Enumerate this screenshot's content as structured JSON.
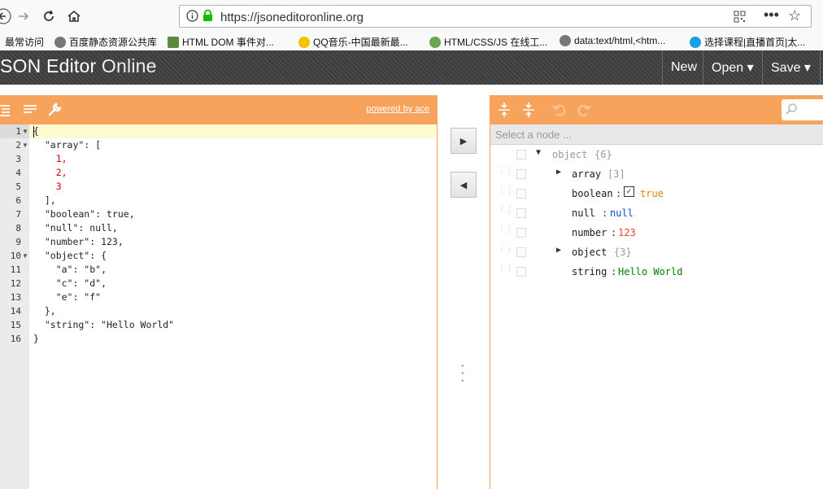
{
  "browser": {
    "url": "https://jsoneditoronline.org",
    "bookmarks": [
      "最常访问",
      "百度静态资源公共库",
      "HTML DOM 事件对...",
      "QQ音乐-中国最新最...",
      "HTML/CSS/JS 在线工...",
      "data:text/html,<htm...",
      "选择课程|直播首页|太..."
    ]
  },
  "app": {
    "title_bold": "SON Editor",
    "title_thin": "Online",
    "menu": {
      "new": "New",
      "open": "Open ▾",
      "save": "Save ▾"
    }
  },
  "left": {
    "powered_by": "powered by ace",
    "line_numbers": [
      "1",
      "2",
      "3",
      "4",
      "5",
      "6",
      "7",
      "8",
      "9",
      "10",
      "11",
      "12",
      "13",
      "14",
      "15",
      "16"
    ],
    "lines": [
      "{",
      "  \"array\": [",
      "    1,",
      "    2,",
      "    3",
      "  ],",
      "  \"boolean\": true,",
      "  \"null\": null,",
      "  \"number\": 123,",
      "  \"object\": {",
      "    \"a\": \"b\",",
      "    \"c\": \"d\",",
      "    \"e\": \"f\"",
      "  },",
      "  \"string\": \"Hello World\"",
      "}"
    ]
  },
  "middle": {
    "to_right": "▶",
    "to_left": "◀"
  },
  "right": {
    "navbar_placeholder": "Select a node ...",
    "tree": {
      "root_label": "object",
      "root_count": "{6}",
      "array_key": "array",
      "array_count": "[3]",
      "boolean_key": "boolean",
      "boolean_value": "true",
      "null_key": "null",
      "null_value": "null",
      "number_key": "number",
      "number_value": "123",
      "object_key": "object",
      "object_count": "{3}",
      "string_key": "string",
      "string_value": "Hello World",
      "separator": ":"
    }
  },
  "colors": {
    "accent": "#f7a35c",
    "header": "#404040"
  }
}
